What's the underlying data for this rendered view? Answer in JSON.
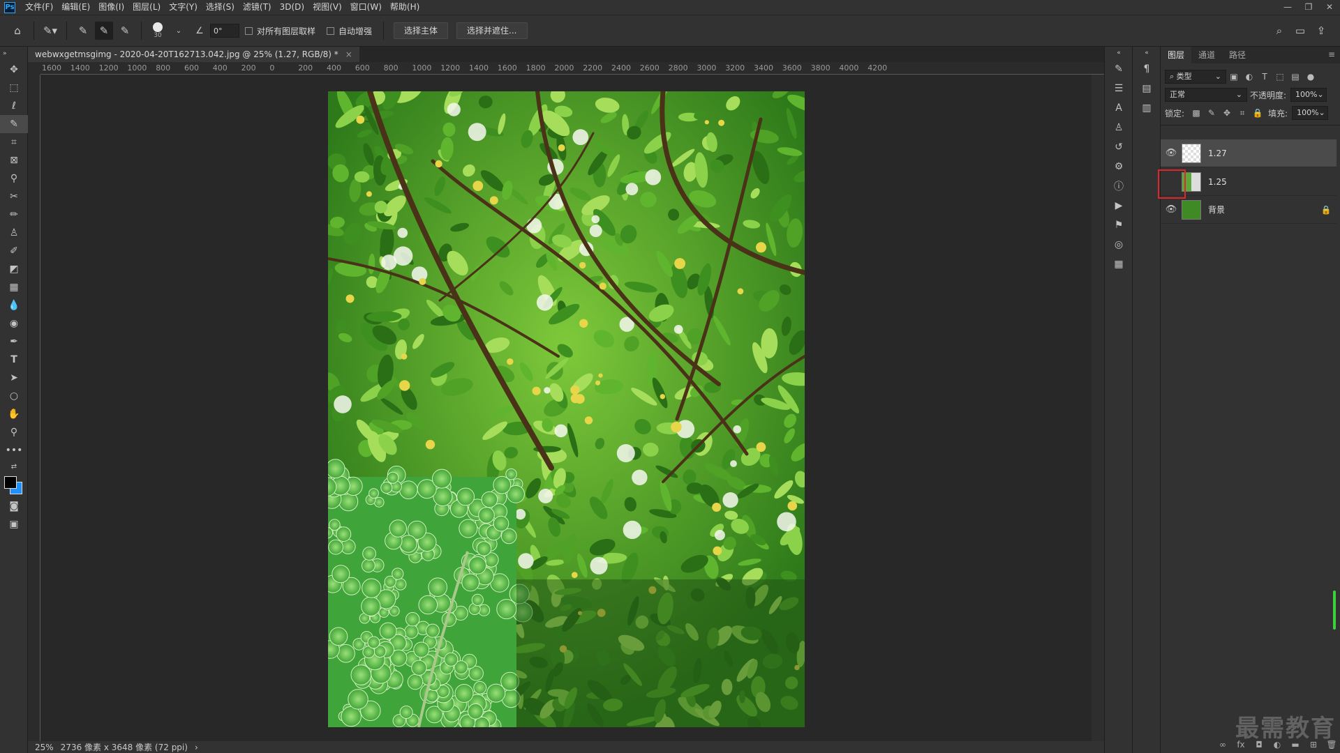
{
  "menu": {
    "app_logo": "Ps",
    "items": [
      "文件(F)",
      "编辑(E)",
      "图像(I)",
      "图层(L)",
      "文字(Y)",
      "选择(S)",
      "滤镜(T)",
      "3D(D)",
      "视图(V)",
      "窗口(W)",
      "帮助(H)"
    ],
    "window_controls": [
      "—",
      "❐",
      "✕"
    ]
  },
  "options": {
    "brush_size": "30",
    "angle_value": "0°",
    "sample_all_layers": "对所有图层取样",
    "auto_enhance": "自动增强",
    "select_subject": "选择主体",
    "select_and_mask": "选择并遮住..."
  },
  "document": {
    "tab_title": "webwxgetmsgimg - 2020-04-20T162713.042.jpg @ 25% (1.27, RGB/8) *",
    "close": "×",
    "ruler_ticks": [
      "1600",
      "1400",
      "1200",
      "1000",
      "800",
      "600",
      "400",
      "200",
      "0",
      "200",
      "400",
      "600",
      "800",
      "1000",
      "1200",
      "1400",
      "1600",
      "1800",
      "2000",
      "2200",
      "2400",
      "2600",
      "2800",
      "3000",
      "3200",
      "3400",
      "3600",
      "3800",
      "4000",
      "4200"
    ]
  },
  "status": {
    "zoom": "25%",
    "dimensions": "2736 像素 x 3648 像素 (72 ppi)",
    "arrow": "›"
  },
  "layers_panel": {
    "tabs": [
      "图层",
      "通道",
      "路径"
    ],
    "filter_kind": "类型",
    "blend_mode": "正常",
    "opacity_label": "不透明度:",
    "opacity_value": "100%",
    "lock_label": "锁定:",
    "fill_label": "填充:",
    "fill_value": "100%",
    "layers": [
      {
        "name": "1.27",
        "visible": true,
        "selected": true,
        "locked": false
      },
      {
        "name": "1.25",
        "visible": false,
        "selected": false,
        "locked": false
      },
      {
        "name": "背景",
        "visible": true,
        "selected": false,
        "locked": true
      }
    ]
  },
  "watermark": "最需教育",
  "colors": {
    "highlight": "#e0262b",
    "foreground": "#000000",
    "background": "#1e90ff"
  }
}
